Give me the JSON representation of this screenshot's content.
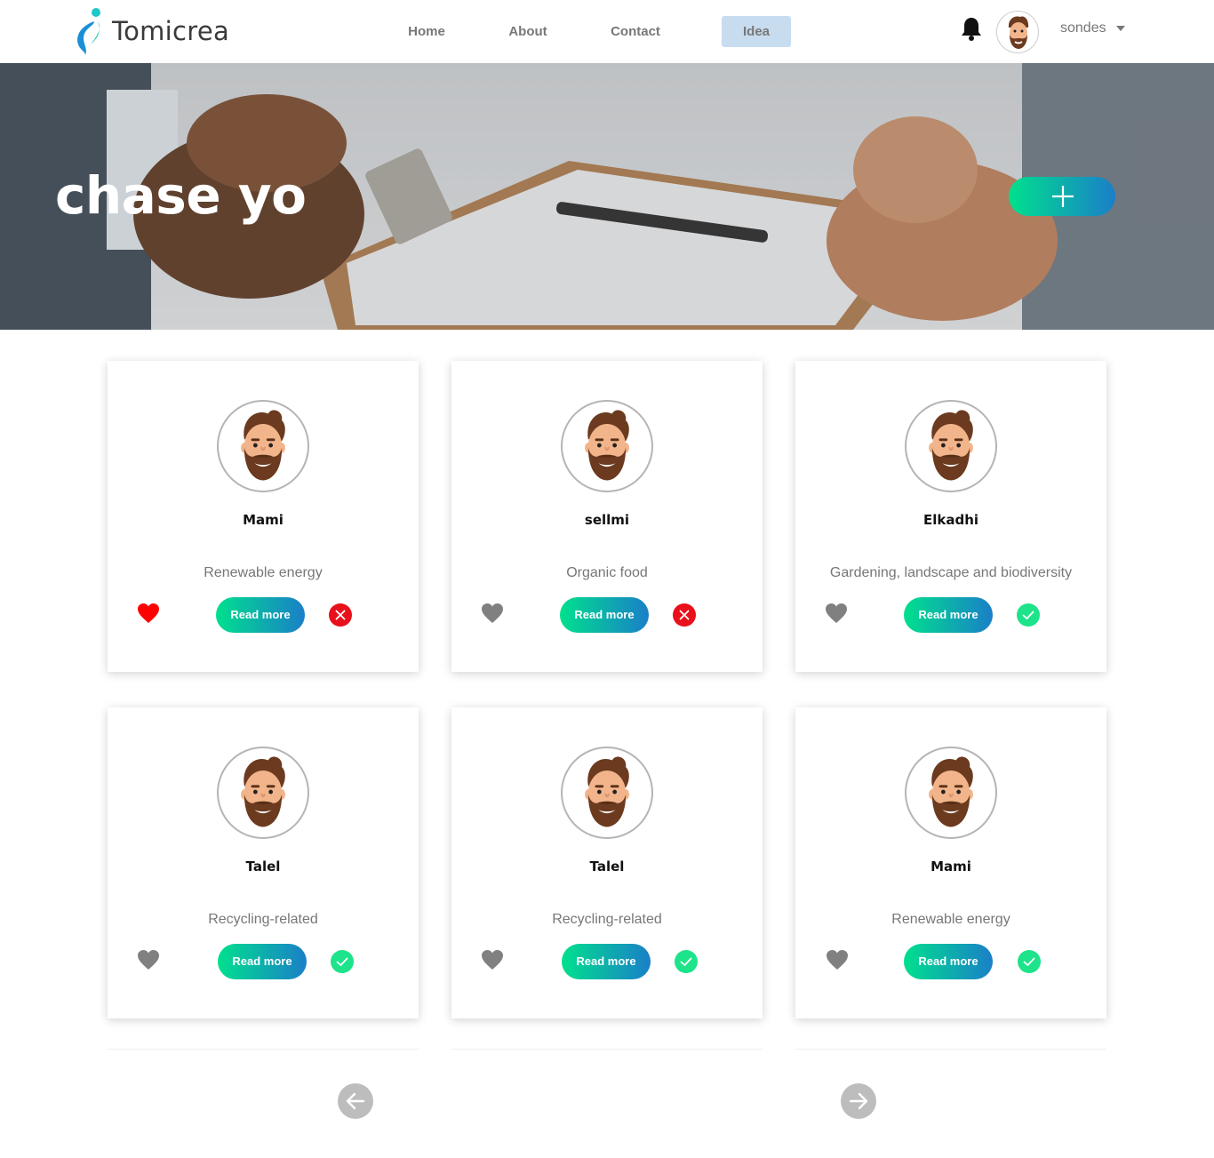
{
  "header": {
    "brand": "Tomicrea",
    "nav": [
      {
        "label": "Home"
      },
      {
        "label": "About"
      },
      {
        "label": "Contact"
      },
      {
        "label": "Idea"
      }
    ],
    "active_nav": "Idea",
    "user_name": "sondes",
    "icons": [
      "bell-icon",
      "avatar",
      "chevron-down-icon"
    ]
  },
  "hero": {
    "title": "chase yo",
    "add_button_icon": "plus-icon"
  },
  "cards": [
    {
      "name": "Mami",
      "category": "Renewable energy",
      "read_label": "Read more",
      "liked": true,
      "status": "rejected"
    },
    {
      "name": "sellmi",
      "category": "Organic food",
      "read_label": "Read more",
      "liked": false,
      "status": "rejected"
    },
    {
      "name": "Elkadhi",
      "category": "Gardening, landscape and biodiversity",
      "read_label": "Read more",
      "liked": false,
      "status": "approved"
    },
    {
      "name": "Talel",
      "category": "Recycling-related",
      "read_label": "Read more",
      "liked": false,
      "status": "approved"
    },
    {
      "name": "Talel",
      "category": "Recycling-related",
      "read_label": "Read more",
      "liked": false,
      "status": "approved"
    },
    {
      "name": "Mami",
      "category": "Renewable energy",
      "read_label": "Read more",
      "liked": false,
      "status": "approved"
    }
  ],
  "pagination": {
    "prev_icon": "arrow-left-icon",
    "next_icon": "arrow-right-icon"
  },
  "colors": {
    "accent_start": "#00e08d",
    "accent_end": "#1a7fc9",
    "liked": "#ff0000",
    "unliked": "#808080",
    "reject": "#e8101a",
    "approve": "#1de38a",
    "nav_active_bg": "#c7dcef"
  }
}
